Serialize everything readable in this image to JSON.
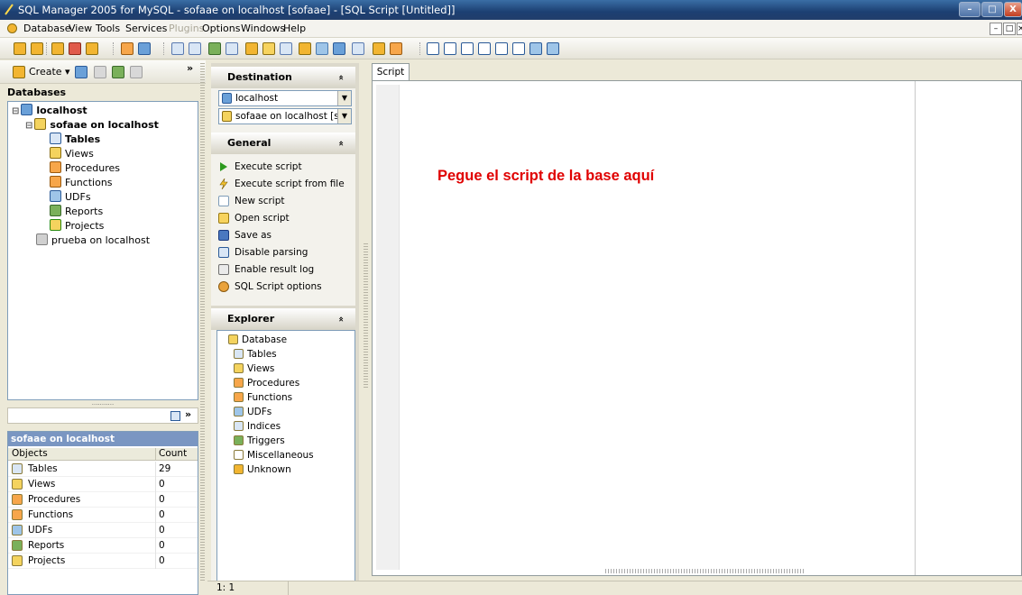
{
  "window": {
    "title": "SQL Manager 2005 for MySQL - sofaae on localhost [sofaae] - [SQL Script [Untitled]]",
    "minimize": "–",
    "maximize": "□",
    "close": "X"
  },
  "menu": [
    "Database",
    "View",
    "Tools",
    "Services",
    "Plugins",
    "Options",
    "Windows",
    "Help"
  ],
  "mdi_controls": [
    "–",
    "□",
    "×"
  ],
  "left_toolbar": {
    "create_label": "Create ▾",
    "more": "»"
  },
  "databases": {
    "header": "Databases",
    "tree": [
      {
        "label": "localhost",
        "bold": true,
        "level": 0,
        "icon": "server-icon"
      },
      {
        "label": "sofaae on localhost",
        "bold": true,
        "level": 1,
        "icon": "database-icon"
      },
      {
        "label": "Tables",
        "bold": true,
        "level": 2,
        "icon": "tables-icon"
      },
      {
        "label": "Views",
        "bold": false,
        "level": 2,
        "icon": "views-icon"
      },
      {
        "label": "Procedures",
        "bold": false,
        "level": 2,
        "icon": "procedures-icon"
      },
      {
        "label": "Functions",
        "bold": false,
        "level": 2,
        "icon": "functions-icon"
      },
      {
        "label": "UDFs",
        "bold": false,
        "level": 2,
        "icon": "udfs-icon"
      },
      {
        "label": "Reports",
        "bold": false,
        "level": 2,
        "icon": "reports-icon"
      },
      {
        "label": "Projects",
        "bold": false,
        "level": 2,
        "icon": "projects-icon"
      },
      {
        "label": "prueba on localhost",
        "bold": false,
        "level": 1,
        "icon": "database-gray-icon"
      }
    ],
    "splitter_dots": "..........."
  },
  "objects_panel": {
    "title": "sofaae on localhost",
    "col_objects": "Objects",
    "col_count": "Count",
    "rows": [
      {
        "name": "Tables",
        "count": "29"
      },
      {
        "name": "Views",
        "count": "0"
      },
      {
        "name": "Procedures",
        "count": "0"
      },
      {
        "name": "Functions",
        "count": "0"
      },
      {
        "name": "UDFs",
        "count": "0"
      },
      {
        "name": "Reports",
        "count": "0"
      },
      {
        "name": "Projects",
        "count": "0"
      }
    ]
  },
  "taskpane": {
    "destination": {
      "header": "Destination",
      "host": "localhost",
      "database": "sofaae on localhost [sofaae]"
    },
    "general": {
      "header": "General",
      "items": [
        "Execute script",
        "Execute script from file",
        "New script",
        "Open script",
        "Save as",
        "Disable parsing",
        "Enable result log",
        "SQL Script options"
      ]
    },
    "explorer": {
      "header": "Explorer",
      "items": [
        "Database",
        "Tables",
        "Views",
        "Procedures",
        "Functions",
        "UDFs",
        "Indices",
        "Triggers",
        "Miscellaneous",
        "Unknown"
      ]
    },
    "chevron": "»"
  },
  "editor": {
    "tab_label": "Script",
    "hint_text": "Pegue el script de la base aquí"
  },
  "statusbar": {
    "position": "1:   1"
  }
}
